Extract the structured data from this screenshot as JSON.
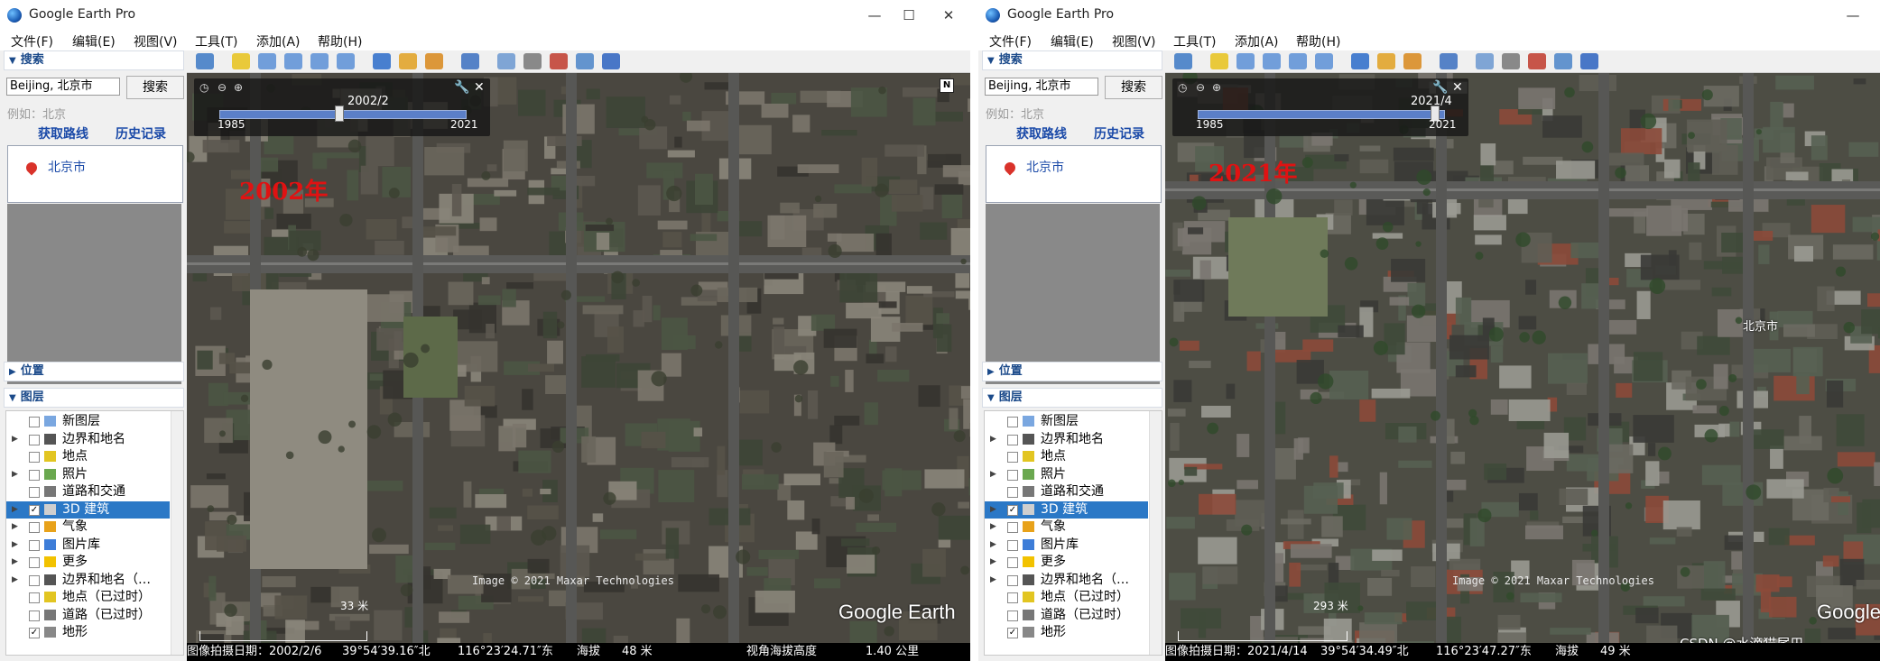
{
  "app_title": "Google Earth Pro",
  "window_controls": {
    "minimize": "—",
    "maximize": "☐",
    "close": "✕"
  },
  "menu": [
    "文件(F)",
    "编辑(E)",
    "视图(V)",
    "工具(T)",
    "添加(A)",
    "帮助(H)"
  ],
  "search": {
    "header": "搜索",
    "input_value": "Beijing, 北京市",
    "button": "搜索",
    "hint": "例如：北京",
    "link_route": "获取路线",
    "link_history": "历史记录",
    "result": "北京市"
  },
  "places": {
    "header": "位置"
  },
  "layers": {
    "header": "图层",
    "items": [
      {
        "label": "新图层",
        "checked": false,
        "expandable": false,
        "icon": "new-layer-icon"
      },
      {
        "label": "边界和地名",
        "checked": false,
        "expandable": true,
        "icon": "borders-icon"
      },
      {
        "label": "地点",
        "checked": false,
        "expandable": false,
        "icon": "places-icon"
      },
      {
        "label": "照片",
        "checked": false,
        "expandable": true,
        "icon": "photos-icon"
      },
      {
        "label": "道路和交通",
        "checked": false,
        "expandable": false,
        "icon": "roads-icon"
      },
      {
        "label": "3D 建筑",
        "checked": true,
        "expandable": true,
        "icon": "buildings-3d-icon",
        "selected": true
      },
      {
        "label": "气象",
        "checked": false,
        "expandable": true,
        "icon": "weather-icon"
      },
      {
        "label": "图片库",
        "checked": false,
        "expandable": true,
        "icon": "gallery-icon"
      },
      {
        "label": "更多",
        "checked": false,
        "expandable": true,
        "icon": "more-icon"
      },
      {
        "label": "边界和地名（…",
        "checked": false,
        "expandable": true,
        "icon": "borders-icon"
      },
      {
        "label": "地点（已过时）",
        "checked": false,
        "expandable": false,
        "icon": "places-icon"
      },
      {
        "label": "道路（已过时）",
        "checked": false,
        "expandable": false,
        "icon": "roads-icon"
      },
      {
        "label": "地形",
        "checked": true,
        "expandable": false,
        "icon": "terrain-icon"
      }
    ]
  },
  "left": {
    "slider": {
      "current": "2002/2",
      "start": "1985",
      "end": "2021",
      "position": 0.48
    },
    "year_annotation": "2002年",
    "copyright": "Image © 2021 Maxar Technologies",
    "brand": "Google Earth",
    "scale": "33 米",
    "status": {
      "date": "图像拍摄日期：2002/2/6",
      "lat": "39°54′39.16″北",
      "lon": "116°23′24.71″东",
      "elev_label": "海拔",
      "elev": "48 米",
      "eye_label": "视角海拔高度",
      "eye": "1.40 公里"
    }
  },
  "right": {
    "slider": {
      "current": "2021/4",
      "start": "1985",
      "end": "2021",
      "position": 0.97
    },
    "year_annotation": "2021年",
    "place_label": "北京市",
    "copyright": "Image © 2021 Maxar Technologies",
    "brand": "Google",
    "scale": "293 米",
    "status": {
      "date": "图像拍摄日期：2021/4/14",
      "lat": "39°54′34.49″北",
      "lon": "116°23′47.27″东",
      "elev_label": "海拔",
      "elev": "49 米"
    },
    "watermark": "CSDN @水滴猫尾巴"
  }
}
